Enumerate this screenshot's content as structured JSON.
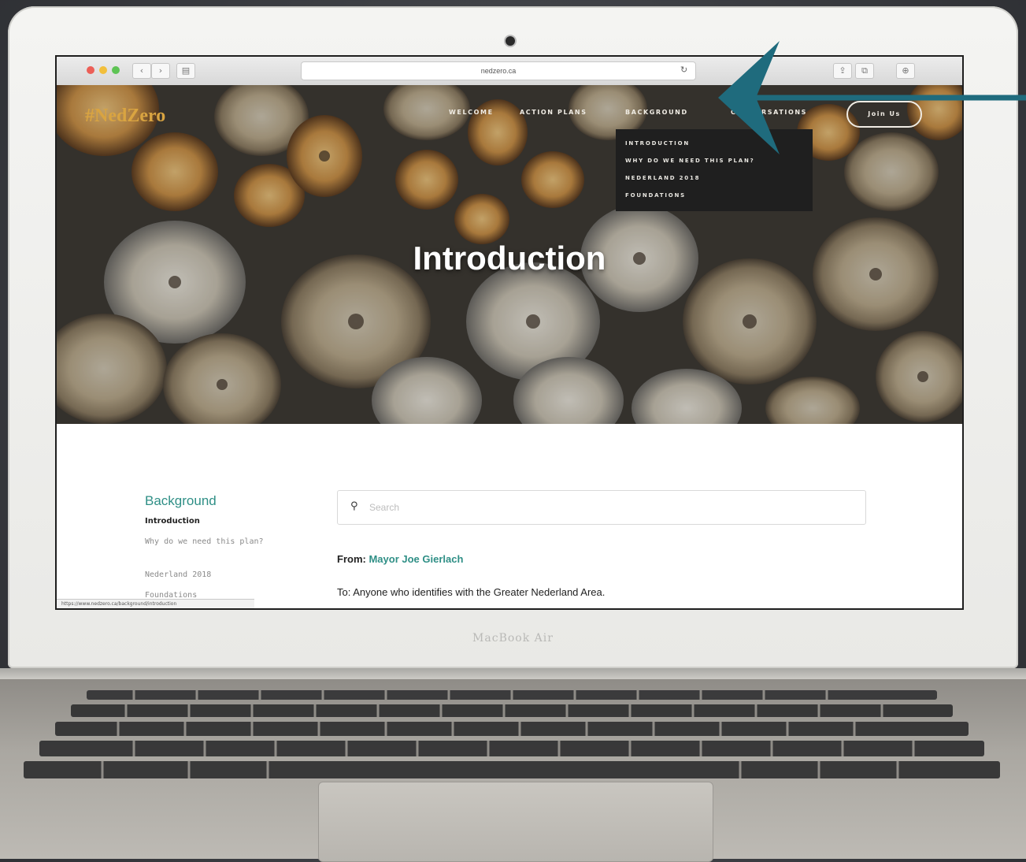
{
  "device": {
    "model_label": "MacBook Air"
  },
  "browser": {
    "address": "nedzero.ca",
    "back_glyph": "‹",
    "forward_glyph": "›",
    "sidebar_glyph": "▤",
    "reload_glyph": "↻",
    "share_glyph": "⇪",
    "tabs_glyph": "⧉",
    "download_glyph": "⊕"
  },
  "site": {
    "logo": "#NedZero",
    "nav": {
      "welcome": "Welcome",
      "action_plans": "Action Plans",
      "background": "Background",
      "conversations": "Conversations",
      "join": "Join Us"
    },
    "dropdown": {
      "items": [
        "Introduction",
        "Why do we need this plan?",
        "Nederland 2018",
        "Foundations"
      ]
    },
    "hero_title": "Introduction"
  },
  "sidebar": {
    "heading": "Background",
    "items": [
      "Introduction",
      "Why do we need this plan?",
      "Nederland 2018",
      "Foundations"
    ]
  },
  "search": {
    "placeholder": "Search",
    "icon": "search-icon"
  },
  "letter": {
    "from_label": "From:",
    "from_name": "Mayor Joe Gierlach",
    "to_line": "To: Anyone who identifies with the Greater Nederland Area."
  },
  "statusbar": {
    "text": "https://www.nedzero.ca/background/introduction"
  },
  "colors": {
    "accent": "#2f8f86",
    "logo": "#d9a441",
    "arrow": "#1f6b7d"
  }
}
